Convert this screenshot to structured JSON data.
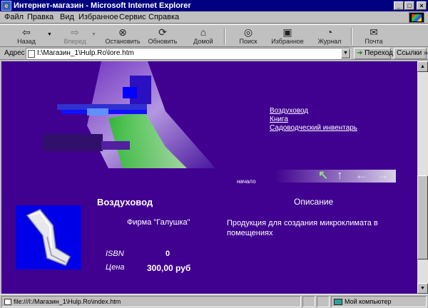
{
  "window": {
    "title": "Интернет-магазин - Microsoft Internet Explorer"
  },
  "menu": [
    "Файл",
    "Правка",
    "Вид",
    "Избранное",
    "Сервис",
    "Справка"
  ],
  "toolbar": [
    {
      "label": "Назад",
      "icon": "back-arrow-icon"
    },
    {
      "label": "Вперед",
      "icon": "forward-arrow-icon"
    },
    {
      "label": "Остановить",
      "icon": "stop-icon"
    },
    {
      "label": "Обновить",
      "icon": "refresh-icon"
    },
    {
      "label": "Домой",
      "icon": "home-icon"
    },
    {
      "label": "Поиск",
      "icon": "search-icon"
    },
    {
      "label": "Избранное",
      "icon": "favorites-icon"
    },
    {
      "label": "Журнал",
      "icon": "history-icon"
    },
    {
      "label": "Почта",
      "icon": "mail-icon"
    }
  ],
  "address": {
    "label": "Адрес",
    "value": "I:\\Магазин_1\\Hulp.Ro\\lore.htm",
    "go_label": "Переход",
    "links_label": "Ссылки"
  },
  "page": {
    "nav_links": [
      "Воздуховод",
      "Книга",
      "Садоводческий инвентарь"
    ],
    "nav_home": "начало",
    "product": {
      "title": "Воздуховод",
      "firm": "Фирма \"Галушка\"",
      "isbn_label": "ISBN",
      "isbn_value": "0",
      "price_label": "Цена",
      "price_value": "300,00 руб"
    },
    "description": {
      "title": "Описание",
      "text": "Продукция для создания микроклимата в помещениях"
    }
  },
  "status": {
    "url": "file:///I:/Магазин_1\\Hulp.Ro\\index.htm",
    "zone": "Мой компьютер"
  },
  "colors": {
    "page_bg": "#400090",
    "titlebar": "#000080",
    "chrome": "#c0c0c0"
  }
}
